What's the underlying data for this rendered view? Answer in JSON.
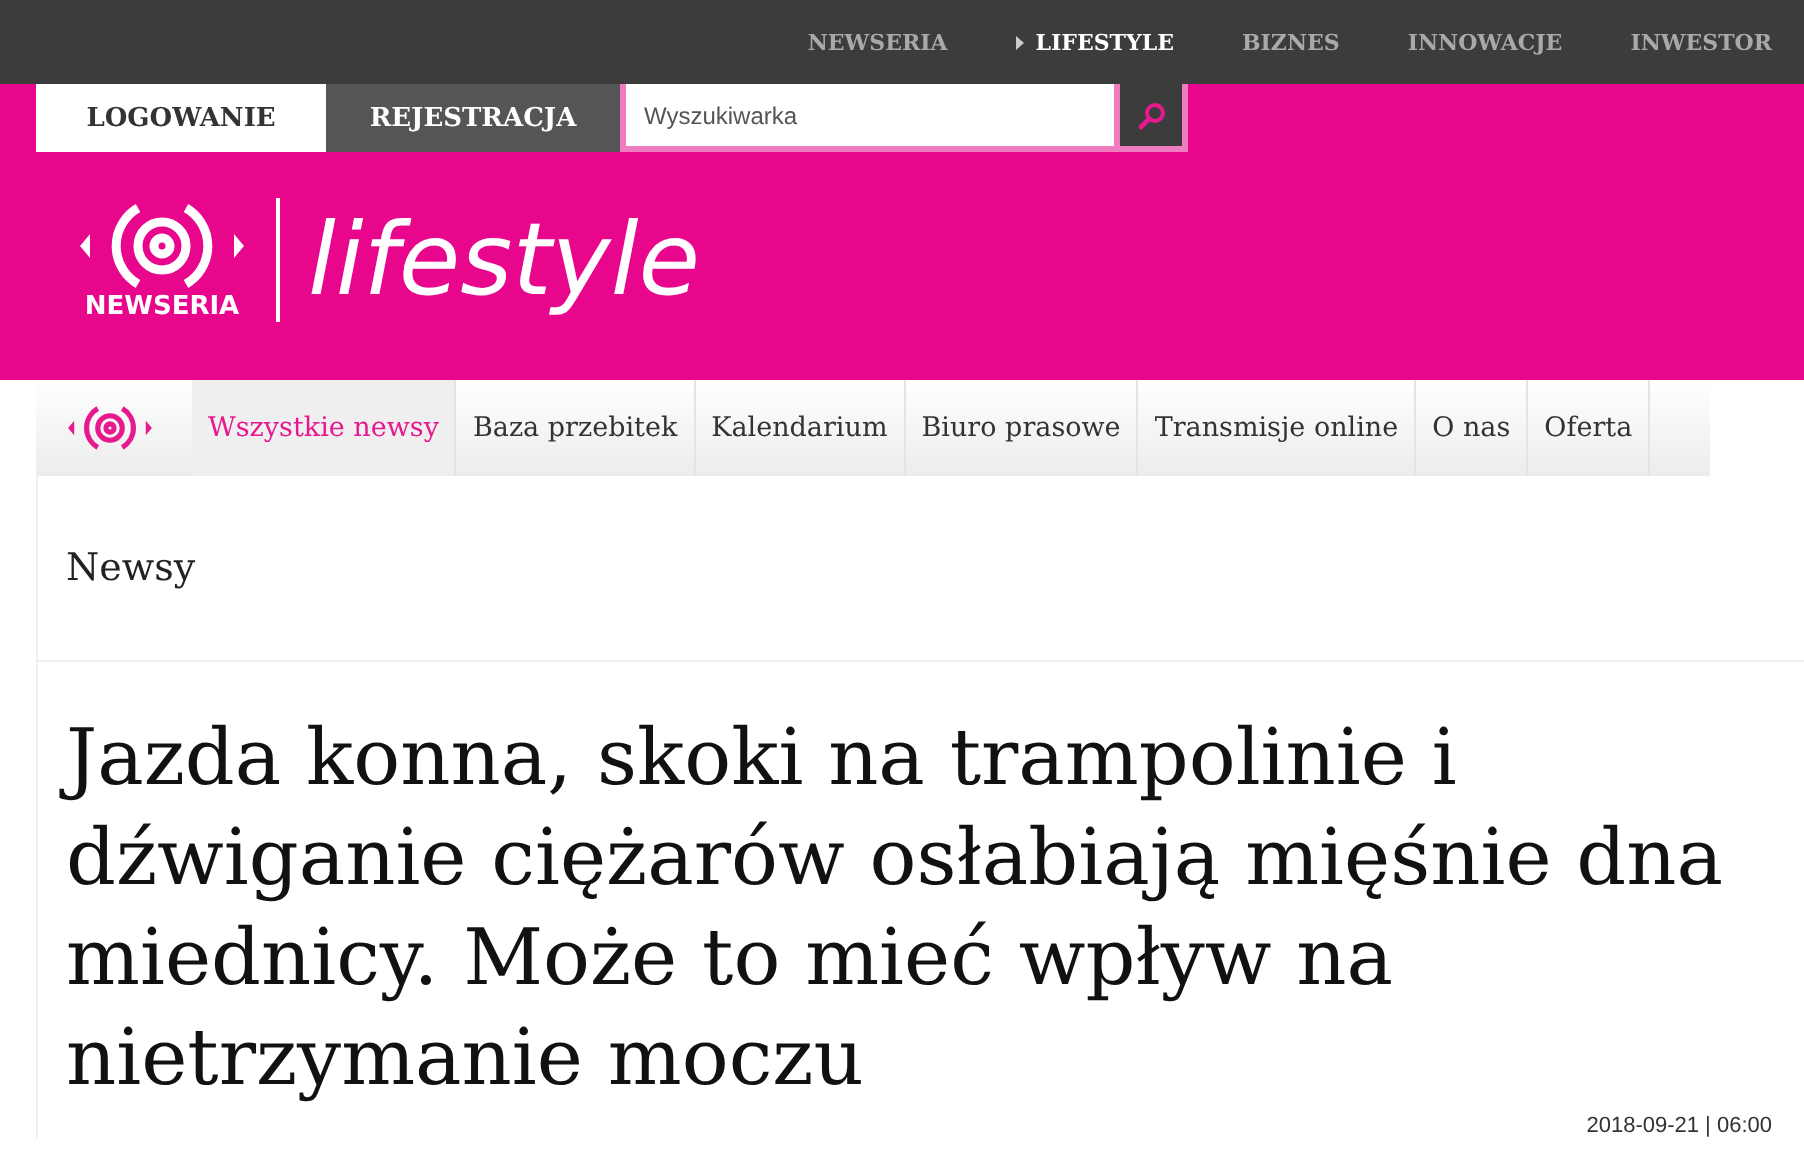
{
  "top_nav": [
    {
      "label": "NEWSERIA",
      "selected": false
    },
    {
      "label": "LIFESTYLE",
      "selected": true
    },
    {
      "label": "BIZNES",
      "selected": false
    },
    {
      "label": "INNOWACJE",
      "selected": false
    },
    {
      "label": "INWESTOR",
      "selected": false
    }
  ],
  "account": {
    "login": "LOGOWANIE",
    "register": "REJESTRACJA"
  },
  "search": {
    "placeholder": "Wyszukiwarka"
  },
  "logo": {
    "brand": "NEWSERIA",
    "section": "lifestyle"
  },
  "main_nav": [
    {
      "label": "Wszystkie newsy",
      "selected": true
    },
    {
      "label": "Baza przebitek",
      "selected": false
    },
    {
      "label": "Kalendarium",
      "selected": false
    },
    {
      "label": "Biuro prasowe",
      "selected": false
    },
    {
      "label": "Transmisje online",
      "selected": false
    },
    {
      "label": "O nas",
      "selected": false
    },
    {
      "label": "Oferta",
      "selected": false
    }
  ],
  "section_title": "Newsy",
  "article": {
    "headline": "Jazda konna, skoki na trampolinie i dźwiganie ciężarów osłabiają mięśnie dna miednicy. Może to mieć wpływ na nietrzymanie moczu",
    "date": "2018-09-21 | 06:00"
  }
}
